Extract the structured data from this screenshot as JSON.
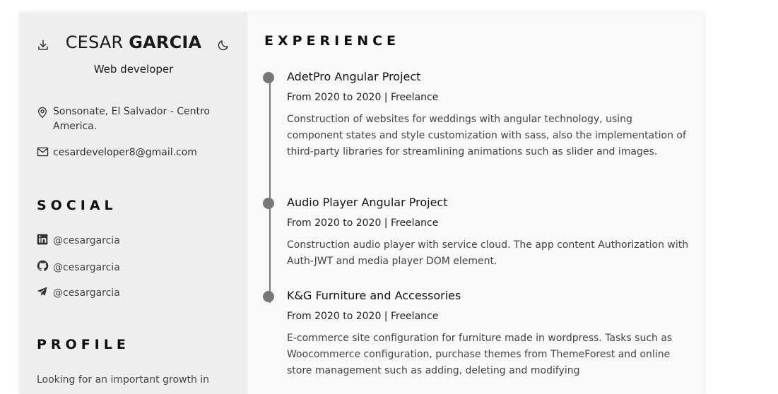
{
  "header": {
    "first_name": "CESAR",
    "last_name": "GARCIA",
    "role": "Web developer"
  },
  "contact": {
    "location": "Sonsonate, El Salvador - Centro America.",
    "email": "cesardeveloper8@gmail.com"
  },
  "social": {
    "title": "SOCIAL",
    "items": [
      {
        "icon": "linkedin-icon",
        "handle": "@cesargarcia"
      },
      {
        "icon": "github-icon",
        "handle": "@cesargarcia"
      },
      {
        "icon": "telegram-icon",
        "handle": "@cesargarcia"
      }
    ]
  },
  "profile": {
    "title": "PROFILE",
    "text": "Looking for an important growth in"
  },
  "experience": {
    "title": "EXPERIENCE",
    "jobs": [
      {
        "title": "AdetPro Angular Project",
        "meta": "From 2020 to 2020 | Freelance",
        "desc": "Construction of websites for weddings with angular technology, using component states and style customization with sass, also the implementation of third-party libraries for streamlining animations such as slider and images."
      },
      {
        "title": "Audio Player Angular Project",
        "meta": "From 2020 to 2020 | Freelance",
        "desc": "Construction audio player with service cloud. The app content Authorization with Auth-JWT and media player DOM element."
      },
      {
        "title": "K&G Furniture and Accessories",
        "meta": "From 2020 to 2020 | Freelance",
        "desc": "E-commerce site configuration for furniture made in wordpress. Tasks such as Woocommerce configuration, purchase themes from ThemeForest and online store management such as adding, deleting and modifying"
      }
    ]
  },
  "colors": {
    "sidebar_bg": "#eeeeee",
    "main_bg": "#f8f8f8",
    "timeline": "#777777"
  }
}
